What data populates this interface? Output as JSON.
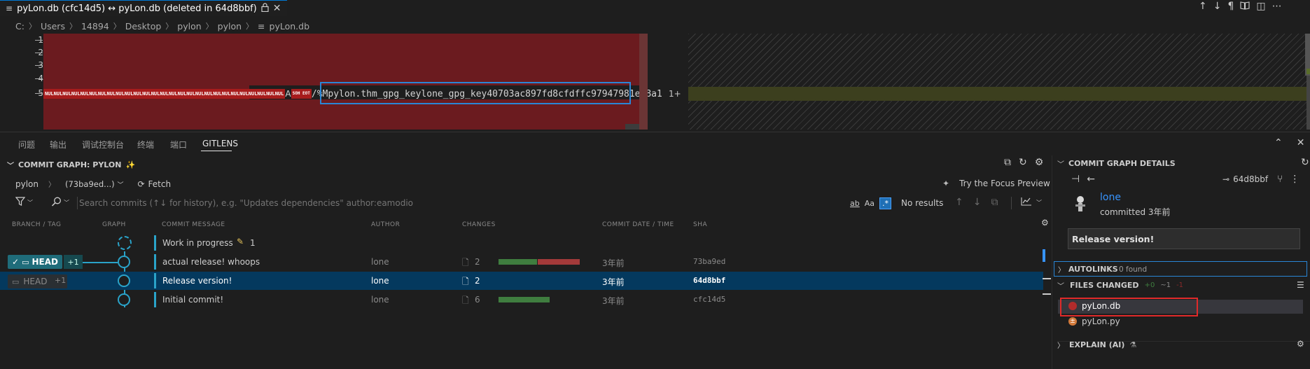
{
  "editor_tab": {
    "title": "pyLon.db (cfc14d5) ↔ pyLon.db (deleted in 64d8bbf)",
    "lock_icon": "lock-icon",
    "close_icon": "close-icon"
  },
  "title_actions": [
    "↑",
    "↓",
    "¶",
    "⇋",
    "◫",
    "⋯"
  ],
  "breadcrumb": [
    "C:",
    "Users",
    "14894",
    "Desktop",
    "pylon",
    "pylon",
    "pyLon.db"
  ],
  "diff_left": {
    "line_numbers": [
      "1",
      "2",
      "3",
      "4",
      "5"
    ],
    "nul_token": "NUL",
    "mid_text": "A",
    "control_token": "SOH EOT",
    "code_text": "/%Mpylon.",
    "selected_text": "thm_gpg_keylone_gpg_key40703ac897fd8cfdffc97947981e88a1"
  },
  "diff_right": {
    "line_number": "1+"
  },
  "panel_tabs": [
    "问题",
    "输出",
    "调试控制台",
    "终端",
    "端口",
    "GITLENS"
  ],
  "commit_graph": {
    "title": "COMMIT GRAPH: PYLON",
    "repo": "pylon",
    "branch": "(73ba9ed...)",
    "fetch": "Fetch",
    "focus_preview": "Try the Focus Preview",
    "search_placeholder": "Search commits (↑↓ for history), e.g. \"Updates dependencies\" author:eamodio",
    "search_opts": [
      "ab",
      "Aa",
      ".*"
    ],
    "no_results": "No results",
    "columns": [
      "BRANCH / TAG",
      "GRAPH",
      "COMMIT MESSAGE",
      "AUTHOR",
      "CHANGES",
      "COMMIT DATE / TIME",
      "SHA"
    ],
    "wip": {
      "message": "Work in progress",
      "count": "1"
    },
    "head_badge": "HEAD",
    "head_plus": "+1",
    "rows": [
      {
        "message": "actual release! whoops",
        "author": "lone",
        "files": "2",
        "date": "3年前",
        "sha": "73ba9ed",
        "add": 0.55,
        "del": 0.6
      },
      {
        "message": "Release version!",
        "author": "lone",
        "files": "2",
        "date": "3年前",
        "sha": "64d8bbf",
        "add": 0,
        "del": 0
      },
      {
        "message": "Initial commit!",
        "author": "lone",
        "files": "6",
        "date": "3年前",
        "sha": "cfc14d5",
        "add": 0.72,
        "del": 0
      }
    ],
    "colors": {
      "add": "#3f7d3f",
      "del": "#a33a3a",
      "graph": "#2aa3c9",
      "selected": "#04395e"
    }
  },
  "details": {
    "title": "COMMIT GRAPH DETAILS",
    "sha": "64d8bbf",
    "author": "lone",
    "committed": "committed 3年前",
    "message": "Release version!",
    "autolinks_label": "AUTOLINKS",
    "autolinks_found": "0 found",
    "files_changed_label": "FILES CHANGED",
    "stats": {
      "add": "+0",
      "mod": "~1",
      "del": "-1"
    },
    "files": [
      "pyLon.db",
      "pyLon.py"
    ],
    "explain_label": "EXPLAIN (AI)"
  }
}
